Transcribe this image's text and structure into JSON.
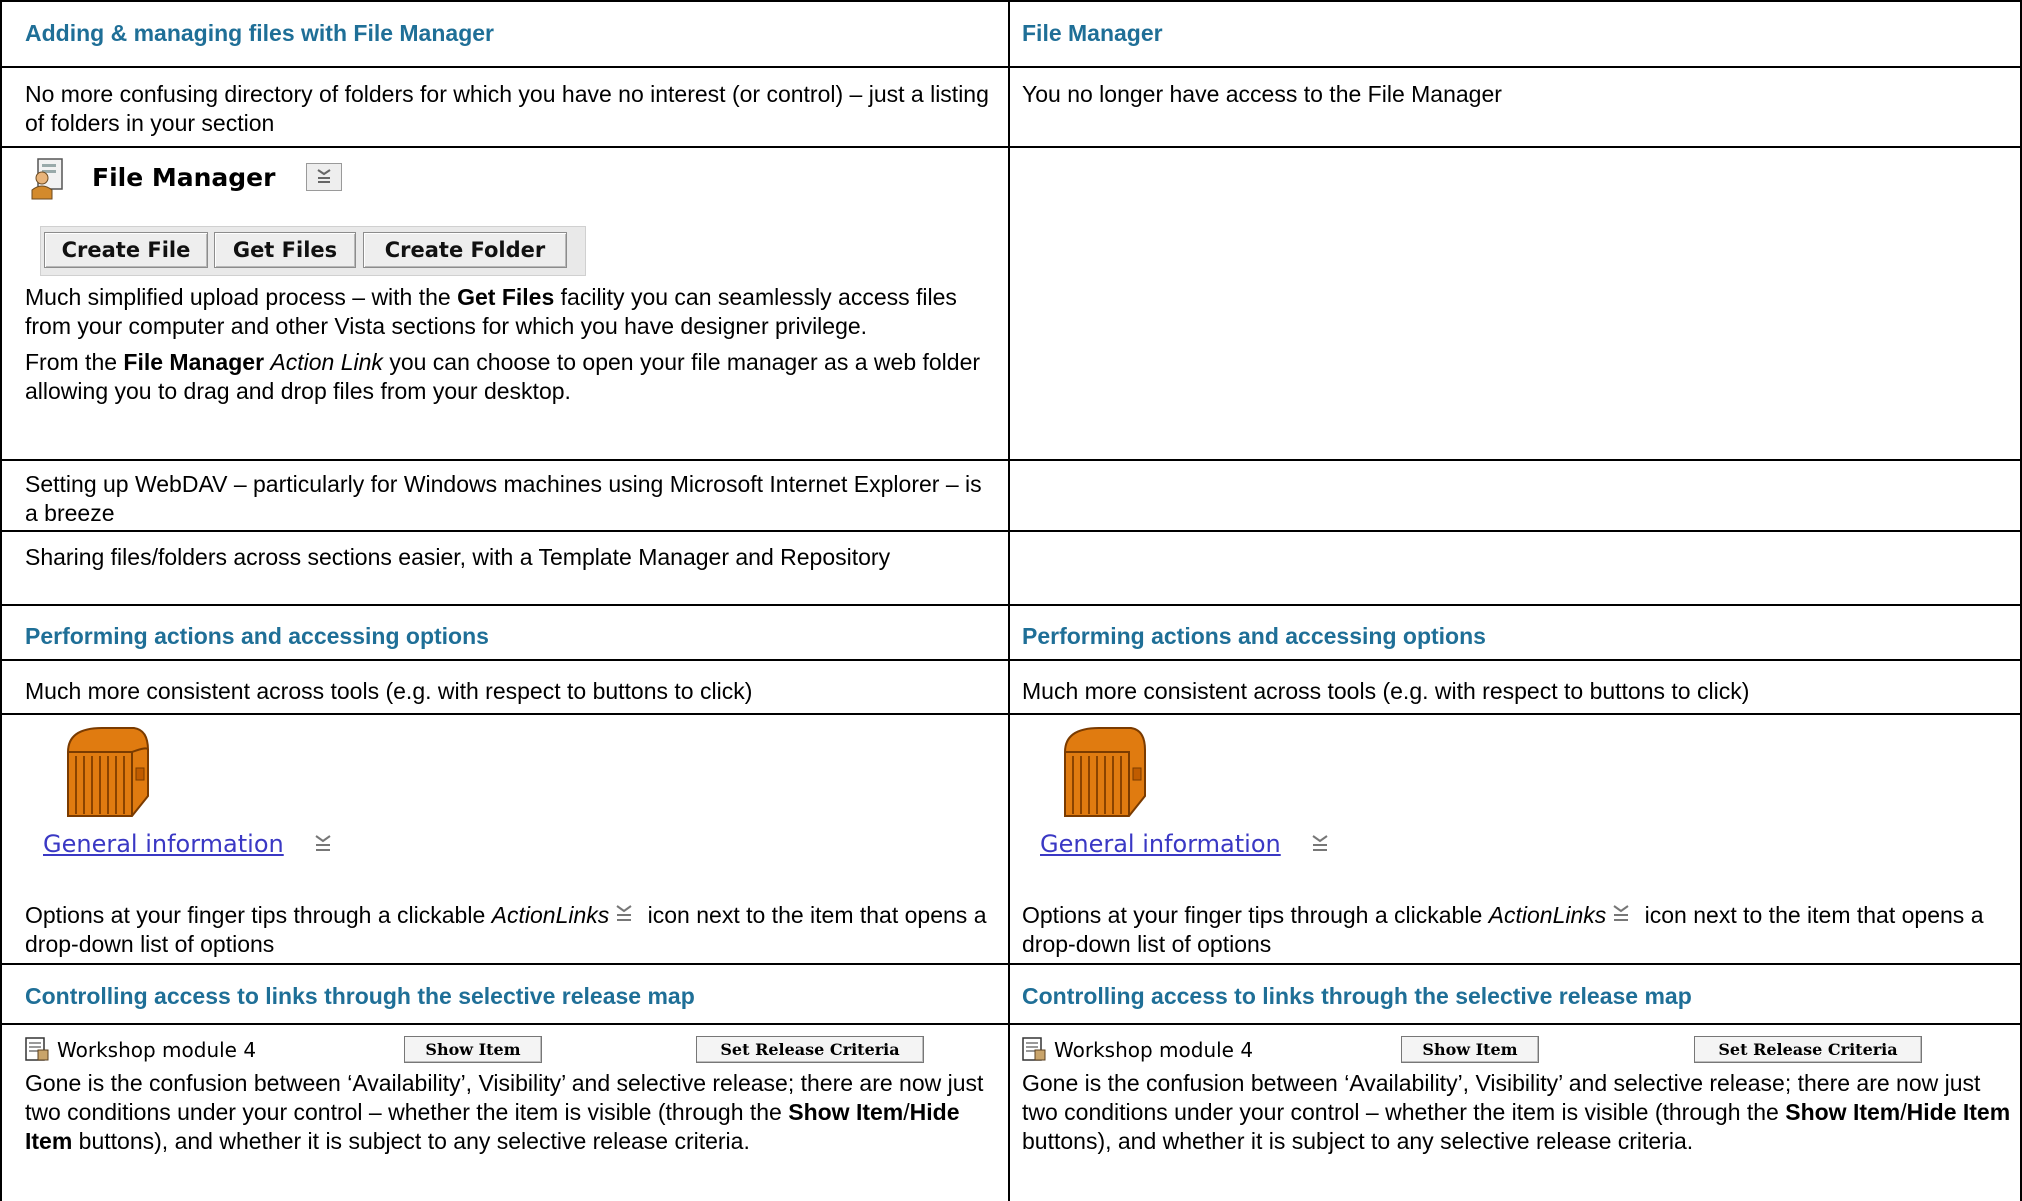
{
  "left": {
    "header1": "Adding & managing files with File Manager",
    "row1": "No more confusing directory of folders for which you have no interest (or control) – just a listing of folders in your section",
    "fm_title": "File Manager",
    "buttons": [
      "Create File",
      "Get Files",
      "Create Folder"
    ],
    "upload_pre": "Much simplified upload process – with the ",
    "upload_bold": "Get Files",
    "upload_post": " facility you can seamlessly access files from your computer and other Vista sections for which you have designer privilege.",
    "from_pre": "From the ",
    "from_bold": "File Manager",
    "from_italic": "Action Link",
    "from_post": " you can choose to open your file manager as a web folder allowing you to drag and drop files from your desktop.",
    "row3": "Setting up WebDAV – particularly for Windows machines using Microsoft Internet Explorer – is a breeze",
    "row4": "Sharing files/folders across sections easier, with a Template Manager and Repository",
    "header2": "Performing actions and accessing options",
    "row5": "Much more consistent across tools (e.g. with respect to buttons to click)",
    "gi_link": "General information",
    "opt_pre": "Options at your finger tips through a clickable ",
    "opt_italic": "ActionLinks",
    "opt_post": " icon next to the item that opens a drop-down list of options",
    "header3": "Controlling access to links through the selective release map",
    "wm_label": "Workshop module 4",
    "show_btn": "Show Item",
    "release_btn": "Set Release Criteria",
    "gone_pre": "Gone is the confusion between ‘Availability’, Visibility’ and selective release; there are now just two conditions under your control – whether the item is visible (through the ",
    "gone_b1": "Show Item",
    "gone_slash": "/",
    "gone_b2": "Hide Item",
    "gone_post": " buttons), and whether it is subject to any selective release criteria."
  },
  "right": {
    "header1": "File Manager",
    "row1": "You no longer have access to the File Manager",
    "header2": "Performing actions and accessing options",
    "row5": "Much more consistent across tools (e.g. with respect to buttons to click)",
    "gi_link": "General information",
    "opt_pre": "Options at your finger tips through a clickable ",
    "opt_italic": "ActionLinks",
    "opt_post": " icon next to the item that opens a drop-down list of options",
    "header3": "Controlling access to links through the selective release map",
    "wm_label": "Workshop module 4",
    "show_btn": "Show Item",
    "release_btn": "Set Release Criteria",
    "gone_pre": "Gone is the confusion between ‘Availability’, Visibility’ and selective release; there are now just two conditions under your control – whether the item is visible (through the ",
    "gone_b1": "Show Item",
    "gone_slash": "/",
    "gone_b2": "Hide Item",
    "gone_post": " buttons), and whether it is subject to any selective release criteria."
  },
  "icons": [
    "file-manager-user-icon",
    "action-links-icon",
    "treasure-chest-icon",
    "content-page-icon"
  ]
}
